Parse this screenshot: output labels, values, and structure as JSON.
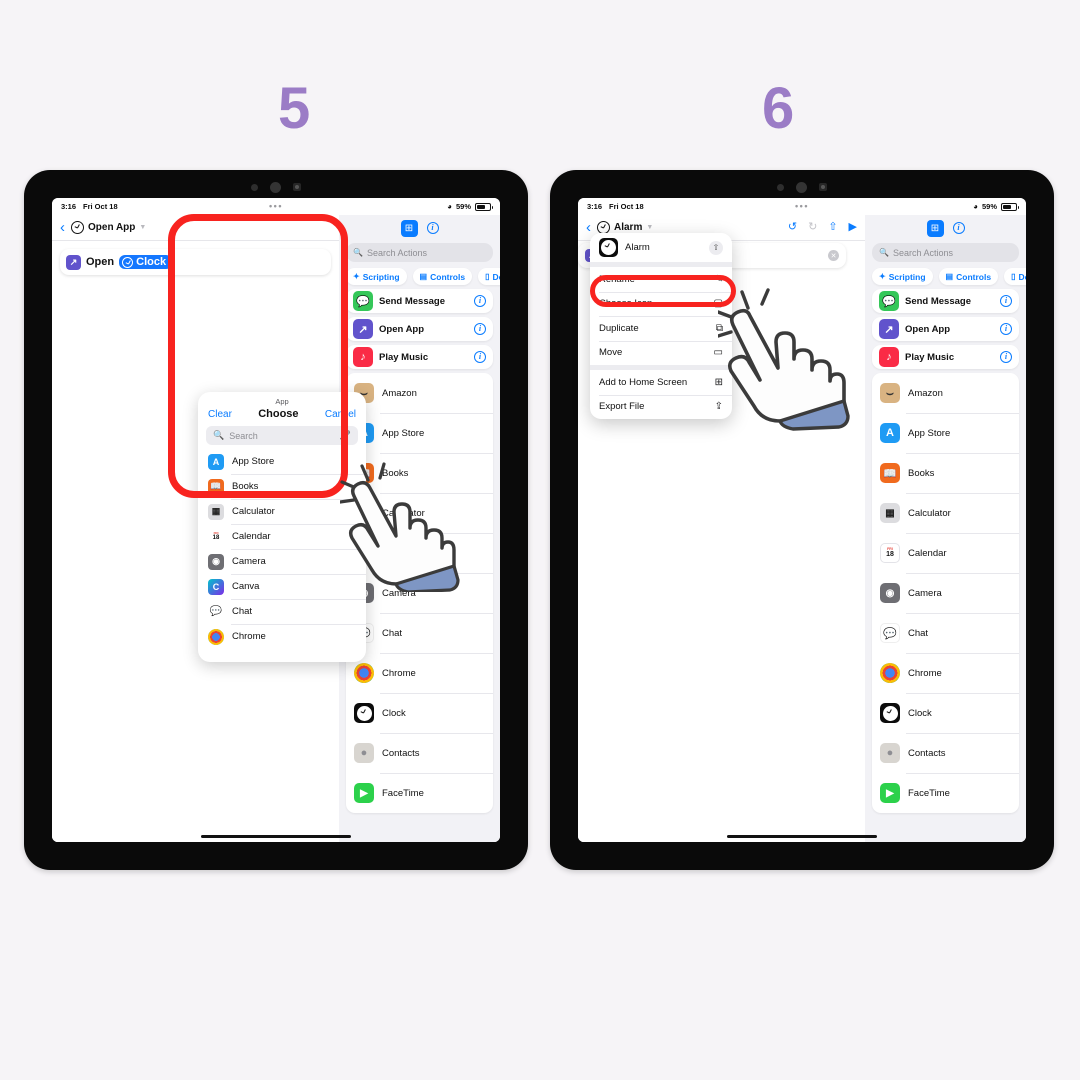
{
  "steps": [
    {
      "number": "5"
    },
    {
      "number": "6"
    }
  ],
  "statusbar": {
    "time": "3:16",
    "date": "Fri Oct 18",
    "dots": "•••",
    "wifi_icon": "wifi-icon",
    "battery_percent": "59%"
  },
  "left_tablet": {
    "nav": {
      "back_icon": "chevron-left-icon",
      "app_icon": "clock-icon",
      "title": "Open App",
      "chevron_icon": "chevron-down-icon"
    },
    "action_card": {
      "verb_icon": "open-app-icon",
      "verb": "Open",
      "token_icon": "clock-icon",
      "token": "Clock"
    },
    "popover": {
      "header": "App",
      "clear_label": "Clear",
      "title": "Choose",
      "cancel_label": "Cancel",
      "search_placeholder": "Search",
      "search_icon": "search-icon",
      "mic_icon": "microphone-icon",
      "apps": [
        {
          "name": "App Store",
          "icon": "app-store-icon"
        },
        {
          "name": "Books",
          "icon": "books-icon"
        },
        {
          "name": "Calculator",
          "icon": "calculator-icon"
        },
        {
          "name": "Calendar",
          "icon": "calendar-icon"
        },
        {
          "name": "Camera",
          "icon": "camera-icon"
        },
        {
          "name": "Canva",
          "icon": "canva-icon"
        },
        {
          "name": "Chat",
          "icon": "chat-icon"
        },
        {
          "name": "Chrome",
          "icon": "chrome-icon"
        }
      ]
    }
  },
  "right_tablet": {
    "nav": {
      "back_icon": "chevron-left-icon",
      "app_icon": "clock-icon",
      "title": "Alarm",
      "chevron_icon": "chevron-down-icon",
      "undo_icon": "undo-icon",
      "redo_icon": "redo-icon",
      "share_icon": "share-icon",
      "play_icon": "play-icon"
    },
    "name_field": {
      "icon": "open-app-icon",
      "value": "",
      "clear_icon": "clear-icon"
    },
    "context_menu": {
      "shortcut_icon": "clock-icon",
      "shortcut_name": "Alarm",
      "share_icon": "share-icon",
      "items": [
        {
          "label": "Rename",
          "icon": "pencil-icon",
          "glyph": "✎",
          "highlighted": true
        },
        {
          "label": "Choose Icon",
          "icon": "choose-icon-icon",
          "glyph": "▢"
        },
        {
          "label": "Duplicate",
          "icon": "duplicate-icon",
          "glyph": "⧉"
        },
        {
          "label": "Move",
          "icon": "folder-icon",
          "glyph": "▭"
        },
        {
          "label": "Add to Home Screen",
          "icon": "add-to-home-icon",
          "glyph": "⊞"
        },
        {
          "label": "Export File",
          "icon": "export-icon",
          "glyph": "⇪"
        }
      ]
    }
  },
  "library": {
    "add_icon": "add-shortcut-icon",
    "info_icon": "info-icon",
    "search_placeholder": "Search Actions",
    "search_icon": "search-icon",
    "chips": [
      {
        "label": "Scripting",
        "icon": "scripting-icon",
        "glyph": "✦"
      },
      {
        "label": "Controls",
        "icon": "controls-icon",
        "glyph": "▤"
      },
      {
        "label": "De",
        "icon": "device-icon",
        "glyph": "▯"
      }
    ],
    "actions": [
      {
        "label": "Send Message",
        "icon": "messages-icon",
        "info_icon": "info-icon"
      },
      {
        "label": "Open App",
        "icon": "open-app-icon",
        "info_icon": "info-icon"
      },
      {
        "label": "Play Music",
        "icon": "music-icon",
        "info_icon": "info-icon"
      }
    ],
    "apps": [
      {
        "name": "Amazon",
        "icon": "amazon-icon"
      },
      {
        "name": "App Store",
        "icon": "app-store-icon"
      },
      {
        "name": "Books",
        "icon": "books-icon"
      },
      {
        "name": "Calculator",
        "icon": "calculator-icon"
      },
      {
        "name": "Calendar",
        "icon": "calendar-icon"
      },
      {
        "name": "Camera",
        "icon": "camera-icon"
      },
      {
        "name": "Chat",
        "icon": "chat-icon"
      },
      {
        "name": "Chrome",
        "icon": "chrome-icon"
      },
      {
        "name": "Clock",
        "icon": "clock-icon"
      },
      {
        "name": "Contacts",
        "icon": "contacts-icon"
      },
      {
        "name": "FaceTime",
        "icon": "facetime-icon"
      }
    ]
  },
  "colors": {
    "background": "#f6f4f7",
    "step_number": "#9b7cc6",
    "highlight_ring": "#f8231f",
    "accent_blue": "#0a7cff",
    "token_blue": "#1477ff"
  },
  "cursor": {
    "icon": "pointing-hand-cursor"
  }
}
